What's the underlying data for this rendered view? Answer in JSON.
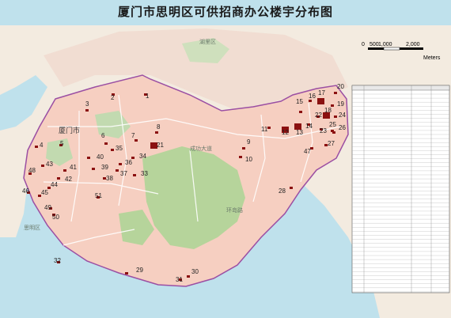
{
  "title": "厦门市思明区可供招商办公楼宇分布图",
  "scale_bar": {
    "ticks": [
      "0",
      "500",
      "1,000",
      "2,000"
    ],
    "unit": "Meters"
  },
  "places": {
    "huli": "湖里区",
    "xiamen_city": "厦门市",
    "siming_district": "思明区",
    "cheng_da_road": "成功大道",
    "huan_island_road": "环岛路"
  },
  "buildings": [
    {
      "id": "1"
    },
    {
      "id": "2"
    },
    {
      "id": "3"
    },
    {
      "id": "4"
    },
    {
      "id": "5"
    },
    {
      "id": "6"
    },
    {
      "id": "7"
    },
    {
      "id": "8"
    },
    {
      "id": "9"
    },
    {
      "id": "10"
    },
    {
      "id": "11"
    },
    {
      "id": "12"
    },
    {
      "id": "13"
    },
    {
      "id": "14"
    },
    {
      "id": "15"
    },
    {
      "id": "16"
    },
    {
      "id": "17"
    },
    {
      "id": "18"
    },
    {
      "id": "19"
    },
    {
      "id": "20"
    },
    {
      "id": "21"
    },
    {
      "id": "22"
    },
    {
      "id": "23"
    },
    {
      "id": "24"
    },
    {
      "id": "25"
    },
    {
      "id": "26"
    },
    {
      "id": "27"
    },
    {
      "id": "28"
    },
    {
      "id": "29"
    },
    {
      "id": "30"
    },
    {
      "id": "31"
    },
    {
      "id": "32"
    },
    {
      "id": "33"
    },
    {
      "id": "34"
    },
    {
      "id": "35"
    },
    {
      "id": "36"
    },
    {
      "id": "37"
    },
    {
      "id": "38"
    },
    {
      "id": "39"
    },
    {
      "id": "40"
    },
    {
      "id": "41"
    },
    {
      "id": "42"
    },
    {
      "id": "43"
    },
    {
      "id": "44"
    },
    {
      "id": "45"
    },
    {
      "id": "46"
    },
    {
      "id": "47"
    },
    {
      "id": "48"
    },
    {
      "id": "49"
    },
    {
      "id": "50"
    },
    {
      "id": "51"
    }
  ],
  "colors": {
    "water": "#bfe1ec",
    "land_out": "#f3ebe0",
    "district": "#f6d3c6",
    "green": "#bcd6a3",
    "building": "#8b1010",
    "boundary": "#9b4fa3"
  }
}
